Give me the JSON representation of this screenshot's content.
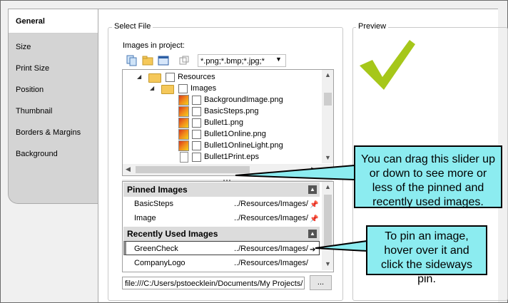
{
  "tabs": [
    "General",
    "Size",
    "Print Size",
    "Position",
    "Thumbnail",
    "Borders & Margins",
    "Background"
  ],
  "select_file": {
    "group_label": "Select File",
    "images_label": "Images in project:",
    "filter_value": "*.png;*.bmp;*.jpg;*",
    "tree": [
      {
        "label": "Resources",
        "type": "folder",
        "indent": 0
      },
      {
        "label": "Images",
        "type": "folder",
        "indent": 1
      },
      {
        "label": "BackgroundImage.png",
        "type": "image",
        "indent": 2
      },
      {
        "label": "BasicSteps.png",
        "type": "image",
        "indent": 2
      },
      {
        "label": "Bullet1.png",
        "type": "image",
        "indent": 2
      },
      {
        "label": "Bullet1Online.png",
        "type": "image",
        "indent": 2
      },
      {
        "label": "Bullet1OnlineLight.png",
        "type": "image",
        "indent": 2
      },
      {
        "label": "Bullet1Print.eps",
        "type": "file",
        "indent": 2
      }
    ],
    "pinned_header": "Pinned Images",
    "pinned": [
      {
        "name": "BasicSteps",
        "path": "../Resources/Images/"
      },
      {
        "name": "Image",
        "path": "../Resources/Images/"
      }
    ],
    "recent_header": "Recently Used Images",
    "recent": [
      {
        "name": "GreenCheck",
        "path": "../Resources/Images/"
      },
      {
        "name": "CompanyLogo",
        "path": "../Resources/Images/"
      }
    ],
    "path_value": "file:///C:/Users/pstoecklein/Documents/My Projects/",
    "browse_label": "..."
  },
  "preview": {
    "group_label": "Preview"
  },
  "callouts": {
    "slider": "You can drag this slider up or down to see more or less of the pinned and recently used images.",
    "pin": "To pin an image, hover over it and click the sideways pin."
  },
  "colors": {
    "callout": "#8cecf0",
    "check": "#a6c71a"
  }
}
